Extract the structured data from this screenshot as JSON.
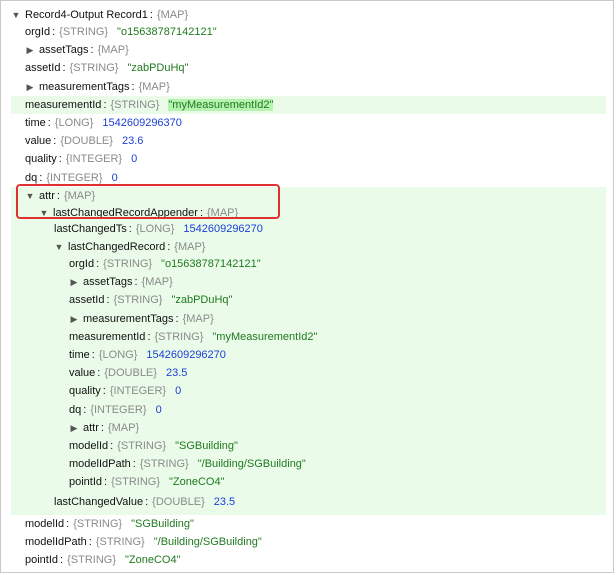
{
  "root": {
    "label": "Record4-Output Record1",
    "type": "{MAP}"
  },
  "top_fields": [
    {
      "key": "orgId",
      "type": "{STRING}",
      "value": "\"o15638787142121\"",
      "kind": "str"
    },
    {
      "key": "assetTags",
      "type": "{MAP}",
      "collapsed": true
    },
    {
      "key": "assetId",
      "type": "{STRING}",
      "value": "\"zabPDuHq\"",
      "kind": "str"
    },
    {
      "key": "measurementTags",
      "type": "{MAP}",
      "collapsed": true
    },
    {
      "key": "measurementId",
      "type": "{STRING}",
      "value": "\"myMeasurementId2\"",
      "kind": "str",
      "highlight": true
    },
    {
      "key": "time",
      "type": "{LONG}",
      "value": "1542609296370",
      "kind": "num"
    },
    {
      "key": "value",
      "type": "{DOUBLE}",
      "value": "23.6",
      "kind": "num"
    },
    {
      "key": "quality",
      "type": "{INTEGER}",
      "value": "0",
      "kind": "num"
    },
    {
      "key": "dq",
      "type": "{INTEGER}",
      "value": "0",
      "kind": "num"
    }
  ],
  "attr": {
    "key": "attr",
    "type": "{MAP}"
  },
  "appender": {
    "key": "lastChangedRecordAppender",
    "type": "{MAP}"
  },
  "lastChangedTs": {
    "key": "lastChangedTs",
    "type": "{LONG}",
    "value": "1542609296270"
  },
  "lastChangedRecord": {
    "key": "lastChangedRecord",
    "type": "{MAP}"
  },
  "record_fields": [
    {
      "key": "orgId",
      "type": "{STRING}",
      "value": "\"o15638787142121\"",
      "kind": "str"
    },
    {
      "key": "assetTags",
      "type": "{MAP}",
      "collapsed": true
    },
    {
      "key": "assetId",
      "type": "{STRING}",
      "value": "\"zabPDuHq\"",
      "kind": "str"
    },
    {
      "key": "measurementTags",
      "type": "{MAP}",
      "collapsed": true
    },
    {
      "key": "measurementId",
      "type": "{STRING}",
      "value": "\"myMeasurementId2\"",
      "kind": "str"
    },
    {
      "key": "time",
      "type": "{LONG}",
      "value": "1542609296270",
      "kind": "num"
    },
    {
      "key": "value",
      "type": "{DOUBLE}",
      "value": "23.5",
      "kind": "num"
    },
    {
      "key": "quality",
      "type": "{INTEGER}",
      "value": "0",
      "kind": "num"
    },
    {
      "key": "dq",
      "type": "{INTEGER}",
      "value": "0",
      "kind": "num"
    },
    {
      "key": "attr",
      "type": "{MAP}",
      "collapsed": true
    },
    {
      "key": "modelId",
      "type": "{STRING}",
      "value": "\"SGBuilding\"",
      "kind": "str"
    },
    {
      "key": "modelIdPath",
      "type": "{STRING}",
      "value": "\"/Building/SGBuilding\"",
      "kind": "str"
    },
    {
      "key": "pointId",
      "type": "{STRING}",
      "value": "\"ZoneCO4\"",
      "kind": "str"
    }
  ],
  "lastChangedValue": {
    "key": "lastChangedValue",
    "type": "{DOUBLE}",
    "value": "23.5"
  },
  "bottom_fields": [
    {
      "key": "modelId",
      "type": "{STRING}",
      "value": "\"SGBuilding\"",
      "kind": "str"
    },
    {
      "key": "modelIdPath",
      "type": "{STRING}",
      "value": "\"/Building/SGBuilding\"",
      "kind": "str"
    },
    {
      "key": "pointId",
      "type": "{STRING}",
      "value": "\"ZoneCO4\"",
      "kind": "str"
    }
  ],
  "icons": {
    "expanded": "▼",
    "collapsed": "▶"
  },
  "colors": {
    "string": "#1f7a1f",
    "number": "#1a3fd6",
    "type": "#8a8a8a",
    "band": "#eafbe9",
    "highlight_box": "#e03131"
  }
}
